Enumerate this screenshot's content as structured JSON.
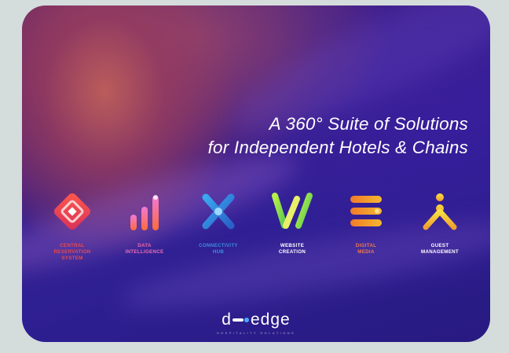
{
  "headline": {
    "line1": "A 360° Suite of Solutions",
    "line2": "for Independent Hotels & Chains"
  },
  "solutions": [
    {
      "label": "CENTRAL\nRESERVATION\nSYSTEM",
      "icon": "crs-diamond-icon",
      "color": "#e8403f"
    },
    {
      "label": "DATA\nINTELLIGENCE",
      "icon": "bar-chart-icon",
      "color": "#e85ca8"
    },
    {
      "label": "CONNECTIVITY\nHUB",
      "icon": "connectivity-x-icon",
      "color": "#2f8de0"
    },
    {
      "label": "WEBSITE\nCREATION",
      "icon": "website-w-icon",
      "color": "#a3e04a"
    },
    {
      "label": "DIGITAL\nMEDIA",
      "icon": "digital-media-bars-icon",
      "color": "#f5a623"
    },
    {
      "label": "GUEST\nMANAGEMENT",
      "icon": "guest-person-icon",
      "color": "#f5d02a"
    }
  ],
  "logo": {
    "brand_start": "d",
    "brand_end": "edge",
    "tagline": "HOSPITALITY SOLUTIONS"
  }
}
